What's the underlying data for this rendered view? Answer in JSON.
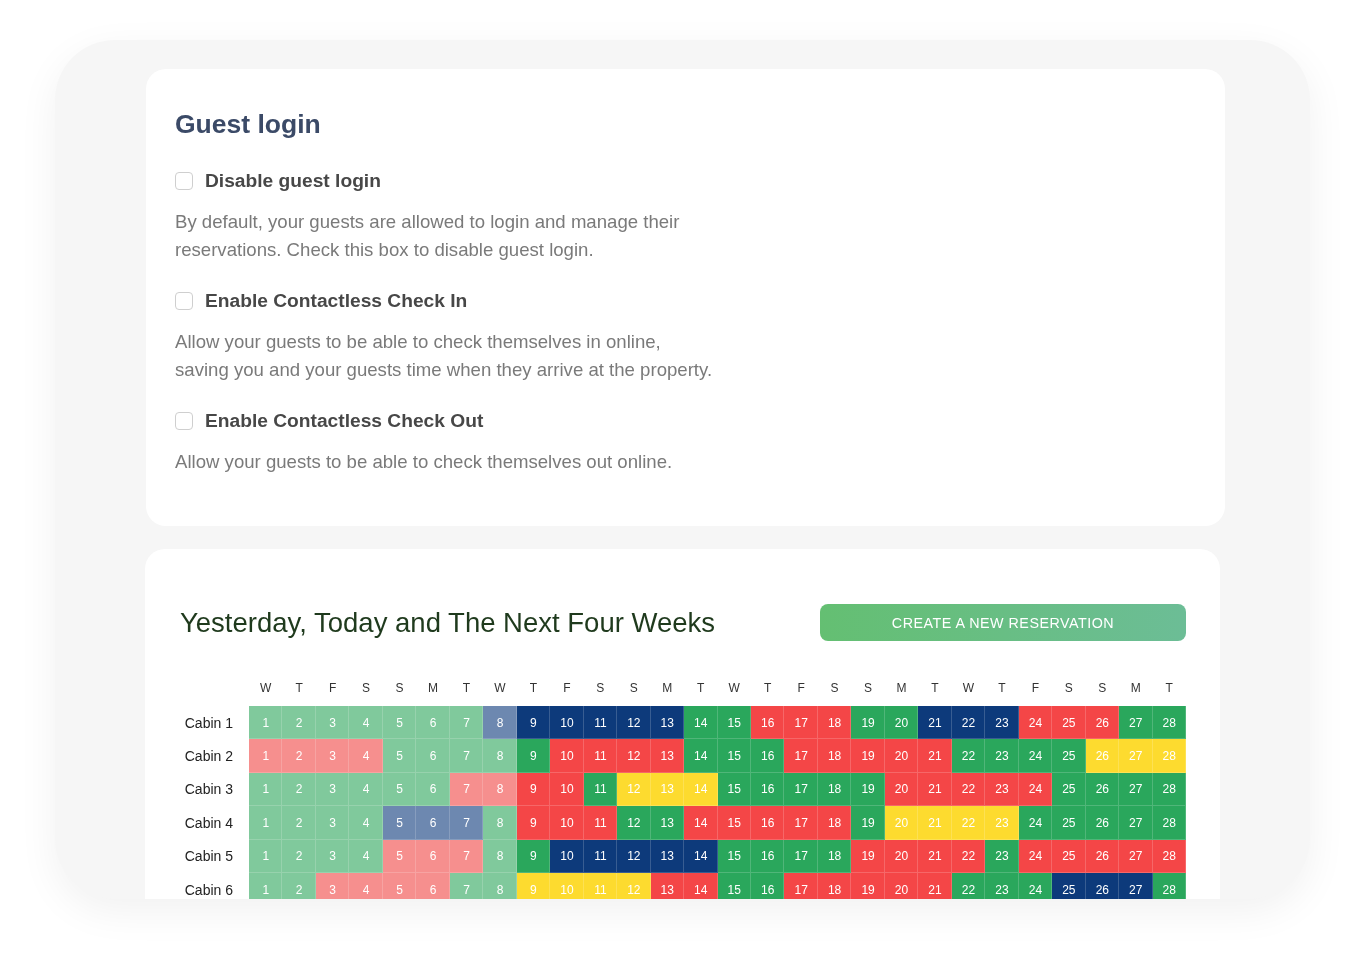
{
  "guest_login": {
    "title": "Guest login",
    "options": [
      {
        "label": "Disable guest login",
        "checked": false,
        "description": "By default, your guests are allowed to login and manage their reservations. Check this box to disable guest login."
      },
      {
        "label": "Enable Contactless Check In",
        "checked": false,
        "description": "Allow your guests to be able to check themselves in online, saving you and your guests time when they arrive at the property."
      },
      {
        "label": "Enable Contactless Check Out",
        "checked": false,
        "description": "Allow your guests to be able to check themselves out online."
      }
    ]
  },
  "calendar": {
    "title": "Yesterday, Today and The Next Four Weeks",
    "button": "CREATE A NEW RESERVATION",
    "weekdays": [
      "W",
      "T",
      "F",
      "S",
      "S",
      "M",
      "T",
      "W",
      "T",
      "F",
      "S",
      "S",
      "M",
      "T",
      "W",
      "T",
      "F",
      "S",
      "S",
      "M",
      "T",
      "W",
      "T",
      "F",
      "S",
      "S",
      "M",
      "T"
    ],
    "rows": [
      {
        "name": "Cabin 1",
        "cells": [
          {
            "day": "1",
            "color": "#80c99c"
          },
          {
            "day": "2",
            "color": "#80c99c"
          },
          {
            "day": "3",
            "color": "#80c99c"
          },
          {
            "day": "4",
            "color": "#80c99c"
          },
          {
            "day": "5",
            "color": "#80c99c"
          },
          {
            "day": "6",
            "color": "#80c99c"
          },
          {
            "day": "7",
            "color": "#80c99c"
          },
          {
            "day": "8",
            "color": "#6d88b0"
          },
          {
            "day": "9",
            "color": "#0d3a7b"
          },
          {
            "day": "10",
            "color": "#0d3a7b"
          },
          {
            "day": "11",
            "color": "#0d3a7b"
          },
          {
            "day": "12",
            "color": "#0d3a7b"
          },
          {
            "day": "13",
            "color": "#0d3a7b"
          },
          {
            "day": "14",
            "color": "#2aa75c"
          },
          {
            "day": "15",
            "color": "#2aa75c"
          },
          {
            "day": "16",
            "color": "#f44647"
          },
          {
            "day": "17",
            "color": "#f44647"
          },
          {
            "day": "18",
            "color": "#f44647"
          },
          {
            "day": "19",
            "color": "#2aa75c"
          },
          {
            "day": "20",
            "color": "#2aa75c"
          },
          {
            "day": "21",
            "color": "#0d3a7b"
          },
          {
            "day": "22",
            "color": "#0d3a7b"
          },
          {
            "day": "23",
            "color": "#0d3a7b"
          },
          {
            "day": "24",
            "color": "#f44647"
          },
          {
            "day": "25",
            "color": "#f44647"
          },
          {
            "day": "26",
            "color": "#f44647"
          },
          {
            "day": "27",
            "color": "#2aa75c"
          },
          {
            "day": "28",
            "color": "#2aa75c"
          }
        ]
      },
      {
        "name": "Cabin 2",
        "cells": [
          {
            "day": "1",
            "color": "#f68f8e"
          },
          {
            "day": "2",
            "color": "#f68f8e"
          },
          {
            "day": "3",
            "color": "#f68f8e"
          },
          {
            "day": "4",
            "color": "#f68f8e"
          },
          {
            "day": "5",
            "color": "#80c99c"
          },
          {
            "day": "6",
            "color": "#80c99c"
          },
          {
            "day": "7",
            "color": "#80c99c"
          },
          {
            "day": "8",
            "color": "#80c99c"
          },
          {
            "day": "9",
            "color": "#2aa75c"
          },
          {
            "day": "10",
            "color": "#f44647"
          },
          {
            "day": "11",
            "color": "#f44647"
          },
          {
            "day": "12",
            "color": "#f44647"
          },
          {
            "day": "13",
            "color": "#f44647"
          },
          {
            "day": "14",
            "color": "#2aa75c"
          },
          {
            "day": "15",
            "color": "#2aa75c"
          },
          {
            "day": "16",
            "color": "#2aa75c"
          },
          {
            "day": "17",
            "color": "#f44647"
          },
          {
            "day": "18",
            "color": "#f44647"
          },
          {
            "day": "19",
            "color": "#f44647"
          },
          {
            "day": "20",
            "color": "#f44647"
          },
          {
            "day": "21",
            "color": "#f44647"
          },
          {
            "day": "22",
            "color": "#2aa75c"
          },
          {
            "day": "23",
            "color": "#2aa75c"
          },
          {
            "day": "24",
            "color": "#2aa75c"
          },
          {
            "day": "25",
            "color": "#2aa75c"
          },
          {
            "day": "26",
            "color": "#fddb2f"
          },
          {
            "day": "27",
            "color": "#fddb2f"
          },
          {
            "day": "28",
            "color": "#fddb2f"
          }
        ]
      },
      {
        "name": "Cabin 3",
        "cells": [
          {
            "day": "1",
            "color": "#80c99c"
          },
          {
            "day": "2",
            "color": "#80c99c"
          },
          {
            "day": "3",
            "color": "#80c99c"
          },
          {
            "day": "4",
            "color": "#80c99c"
          },
          {
            "day": "5",
            "color": "#80c99c"
          },
          {
            "day": "6",
            "color": "#80c99c"
          },
          {
            "day": "7",
            "color": "#f68f8e"
          },
          {
            "day": "8",
            "color": "#f68f8e"
          },
          {
            "day": "9",
            "color": "#f44647"
          },
          {
            "day": "10",
            "color": "#f44647"
          },
          {
            "day": "11",
            "color": "#2aa75c"
          },
          {
            "day": "12",
            "color": "#fddb2f"
          },
          {
            "day": "13",
            "color": "#fddb2f"
          },
          {
            "day": "14",
            "color": "#fddb2f"
          },
          {
            "day": "15",
            "color": "#2aa75c"
          },
          {
            "day": "16",
            "color": "#2aa75c"
          },
          {
            "day": "17",
            "color": "#2aa75c"
          },
          {
            "day": "18",
            "color": "#2aa75c"
          },
          {
            "day": "19",
            "color": "#2aa75c"
          },
          {
            "day": "20",
            "color": "#f44647"
          },
          {
            "day": "21",
            "color": "#f44647"
          },
          {
            "day": "22",
            "color": "#f44647"
          },
          {
            "day": "23",
            "color": "#f44647"
          },
          {
            "day": "24",
            "color": "#f44647"
          },
          {
            "day": "25",
            "color": "#2aa75c"
          },
          {
            "day": "26",
            "color": "#2aa75c"
          },
          {
            "day": "27",
            "color": "#2aa75c"
          },
          {
            "day": "28",
            "color": "#2aa75c"
          }
        ]
      },
      {
        "name": "Cabin 4",
        "cells": [
          {
            "day": "1",
            "color": "#80c99c"
          },
          {
            "day": "2",
            "color": "#80c99c"
          },
          {
            "day": "3",
            "color": "#80c99c"
          },
          {
            "day": "4",
            "color": "#80c99c"
          },
          {
            "day": "5",
            "color": "#6d88b0"
          },
          {
            "day": "6",
            "color": "#6d88b0"
          },
          {
            "day": "7",
            "color": "#6d88b0"
          },
          {
            "day": "8",
            "color": "#80c99c"
          },
          {
            "day": "9",
            "color": "#f44647"
          },
          {
            "day": "10",
            "color": "#f44647"
          },
          {
            "day": "11",
            "color": "#f44647"
          },
          {
            "day": "12",
            "color": "#2aa75c"
          },
          {
            "day": "13",
            "color": "#2aa75c"
          },
          {
            "day": "14",
            "color": "#f44647"
          },
          {
            "day": "15",
            "color": "#f44647"
          },
          {
            "day": "16",
            "color": "#f44647"
          },
          {
            "day": "17",
            "color": "#f44647"
          },
          {
            "day": "18",
            "color": "#f44647"
          },
          {
            "day": "19",
            "color": "#2aa75c"
          },
          {
            "day": "20",
            "color": "#fddb2f"
          },
          {
            "day": "21",
            "color": "#fddb2f"
          },
          {
            "day": "22",
            "color": "#fddb2f"
          },
          {
            "day": "23",
            "color": "#fddb2f"
          },
          {
            "day": "24",
            "color": "#2aa75c"
          },
          {
            "day": "25",
            "color": "#2aa75c"
          },
          {
            "day": "26",
            "color": "#2aa75c"
          },
          {
            "day": "27",
            "color": "#2aa75c"
          },
          {
            "day": "28",
            "color": "#2aa75c"
          }
        ]
      },
      {
        "name": "Cabin 5",
        "cells": [
          {
            "day": "1",
            "color": "#80c99c"
          },
          {
            "day": "2",
            "color": "#80c99c"
          },
          {
            "day": "3",
            "color": "#80c99c"
          },
          {
            "day": "4",
            "color": "#80c99c"
          },
          {
            "day": "5",
            "color": "#f68f8e"
          },
          {
            "day": "6",
            "color": "#f68f8e"
          },
          {
            "day": "7",
            "color": "#f68f8e"
          },
          {
            "day": "8",
            "color": "#80c99c"
          },
          {
            "day": "9",
            "color": "#2aa75c"
          },
          {
            "day": "10",
            "color": "#0d3a7b"
          },
          {
            "day": "11",
            "color": "#0d3a7b"
          },
          {
            "day": "12",
            "color": "#0d3a7b"
          },
          {
            "day": "13",
            "color": "#0d3a7b"
          },
          {
            "day": "14",
            "color": "#0d3a7b"
          },
          {
            "day": "15",
            "color": "#2aa75c"
          },
          {
            "day": "16",
            "color": "#2aa75c"
          },
          {
            "day": "17",
            "color": "#2aa75c"
          },
          {
            "day": "18",
            "color": "#2aa75c"
          },
          {
            "day": "19",
            "color": "#f44647"
          },
          {
            "day": "20",
            "color": "#f44647"
          },
          {
            "day": "21",
            "color": "#f44647"
          },
          {
            "day": "22",
            "color": "#f44647"
          },
          {
            "day": "23",
            "color": "#2aa75c"
          },
          {
            "day": "24",
            "color": "#f44647"
          },
          {
            "day": "25",
            "color": "#f44647"
          },
          {
            "day": "26",
            "color": "#f44647"
          },
          {
            "day": "27",
            "color": "#f44647"
          },
          {
            "day": "28",
            "color": "#f44647"
          }
        ]
      },
      {
        "name": "Cabin 6",
        "cells": [
          {
            "day": "1",
            "color": "#80c99c"
          },
          {
            "day": "2",
            "color": "#80c99c"
          },
          {
            "day": "3",
            "color": "#f68f8e"
          },
          {
            "day": "4",
            "color": "#f68f8e"
          },
          {
            "day": "5",
            "color": "#f68f8e"
          },
          {
            "day": "6",
            "color": "#f68f8e"
          },
          {
            "day": "7",
            "color": "#80c99c"
          },
          {
            "day": "8",
            "color": "#80c99c"
          },
          {
            "day": "9",
            "color": "#fddb2f"
          },
          {
            "day": "10",
            "color": "#fddb2f"
          },
          {
            "day": "11",
            "color": "#fddb2f"
          },
          {
            "day": "12",
            "color": "#fddb2f"
          },
          {
            "day": "13",
            "color": "#f44647"
          },
          {
            "day": "14",
            "color": "#f44647"
          },
          {
            "day": "15",
            "color": "#2aa75c"
          },
          {
            "day": "16",
            "color": "#2aa75c"
          },
          {
            "day": "17",
            "color": "#f44647"
          },
          {
            "day": "18",
            "color": "#f44647"
          },
          {
            "day": "19",
            "color": "#f44647"
          },
          {
            "day": "20",
            "color": "#f44647"
          },
          {
            "day": "21",
            "color": "#f44647"
          },
          {
            "day": "22",
            "color": "#2aa75c"
          },
          {
            "day": "23",
            "color": "#2aa75c"
          },
          {
            "day": "24",
            "color": "#2aa75c"
          },
          {
            "day": "25",
            "color": "#0d3a7b"
          },
          {
            "day": "26",
            "color": "#0d3a7b"
          },
          {
            "day": "27",
            "color": "#0d3a7b"
          },
          {
            "day": "28",
            "color": "#2aa75c"
          }
        ]
      }
    ]
  }
}
